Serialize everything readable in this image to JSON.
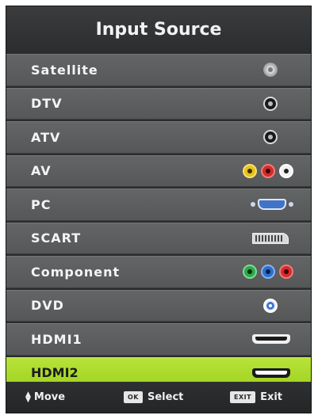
{
  "menu": {
    "title": "Input Source",
    "items": [
      {
        "label": "Satellite",
        "icon": "satellite-connector-icon"
      },
      {
        "label": "DTV",
        "icon": "coax-connector-icon"
      },
      {
        "label": "ATV",
        "icon": "coax-connector-icon"
      },
      {
        "label": "AV",
        "icon": "rca-composite-icon"
      },
      {
        "label": "PC",
        "icon": "vga-connector-icon"
      },
      {
        "label": "SCART",
        "icon": "scart-connector-icon"
      },
      {
        "label": "Component",
        "icon": "rca-component-icon"
      },
      {
        "label": "DVD",
        "icon": "dvd-connector-icon"
      },
      {
        "label": "HDMI1",
        "icon": "hdmi-connector-icon"
      },
      {
        "label": "HDMI2",
        "icon": "hdmi-connector-icon"
      }
    ],
    "selected": "HDMI2"
  },
  "footer": {
    "move_label": "Move",
    "ok_key": "OK",
    "select_label": "Select",
    "exit_key": "EXIT",
    "exit_label": "Exit"
  },
  "colors": {
    "highlight": "#a9d82a",
    "row": "#5d5f60",
    "background": "#2a2c2e",
    "rca_yellow": "#e8c21a",
    "rca_red": "#d42b2b",
    "rca_green": "#2fa84a",
    "rca_blue": "#2d6fd0"
  }
}
